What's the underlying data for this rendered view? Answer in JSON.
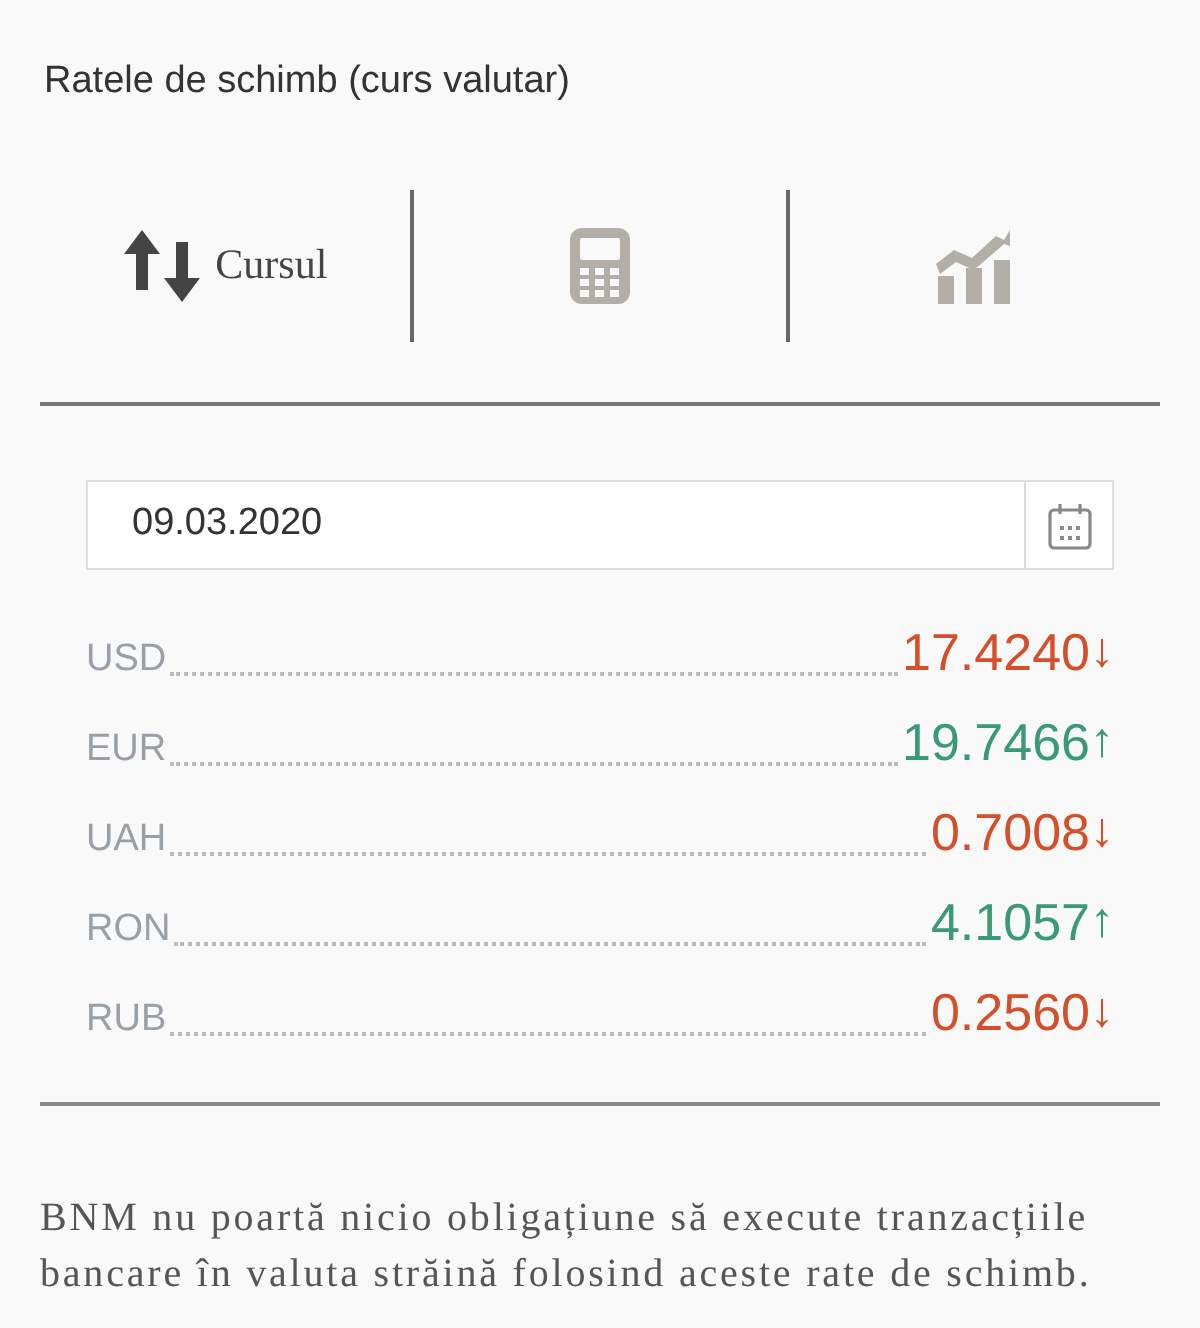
{
  "title": "Ratele de schimb (curs valutar)",
  "tabs": [
    {
      "kind": "rates",
      "label": "Cursul",
      "selected": true
    },
    {
      "kind": "calculator",
      "selected": false
    },
    {
      "kind": "chart",
      "selected": false
    }
  ],
  "date_field": {
    "value": "09.03.2020"
  },
  "rates": [
    {
      "code": "USD",
      "value": "17.4240",
      "arrow": "↓",
      "kind": "down"
    },
    {
      "code": "EUR",
      "value": "19.7466",
      "arrow": "↑",
      "kind": "up"
    },
    {
      "code": "UAH",
      "value": "0.7008",
      "arrow": "↓",
      "kind": "down"
    },
    {
      "code": "RON",
      "value": "4.1057",
      "arrow": "↑",
      "kind": "up"
    },
    {
      "code": "RUB",
      "value": "0.2560",
      "arrow": "↓",
      "kind": "down"
    }
  ],
  "disclaimer": "BNM nu poartă nicio obligațiune să execute tranzacțiile bancare în valuta străină folosind aceste rate de schimb."
}
